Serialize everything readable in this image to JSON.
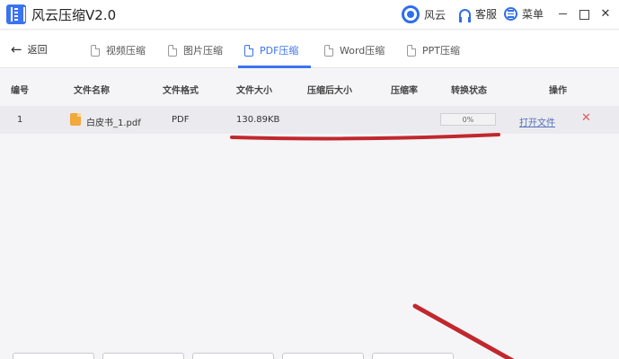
{
  "titlebar": {
    "app_title": "风云压缩V2.0",
    "brand_label": "风云",
    "service_label": "客服",
    "menu_label": "菜单",
    "close_glyph": "✕"
  },
  "nav": {
    "back_label": "返回",
    "tabs": [
      {
        "label": "视频压缩",
        "icon": "video-file-icon",
        "active": false
      },
      {
        "label": "图片压缩",
        "icon": "image-file-icon",
        "active": false
      },
      {
        "label": "PDF压缩",
        "icon": "pdf-file-icon",
        "active": true
      },
      {
        "label": "Word压缩",
        "icon": "word-file-icon",
        "active": false
      },
      {
        "label": "PPT压缩",
        "icon": "ppt-file-icon",
        "active": false
      }
    ]
  },
  "table": {
    "headers": [
      "编号",
      "文件名称",
      "文件格式",
      "文件大小",
      "压缩后大小",
      "压缩率",
      "转换状态",
      "操作"
    ],
    "rows": [
      {
        "index": "1",
        "name": "白皮书_1.pdf",
        "format": "PDF",
        "size": "130.89KB",
        "compressed_size": "",
        "ratio": "",
        "progress_text": "0%",
        "progress_value": 0,
        "action_open": "打开文件",
        "action_delete": "✕"
      }
    ]
  },
  "colors": {
    "accent": "#3b73f0",
    "annotation": "#c0282d",
    "delete": "#e05a5a"
  }
}
